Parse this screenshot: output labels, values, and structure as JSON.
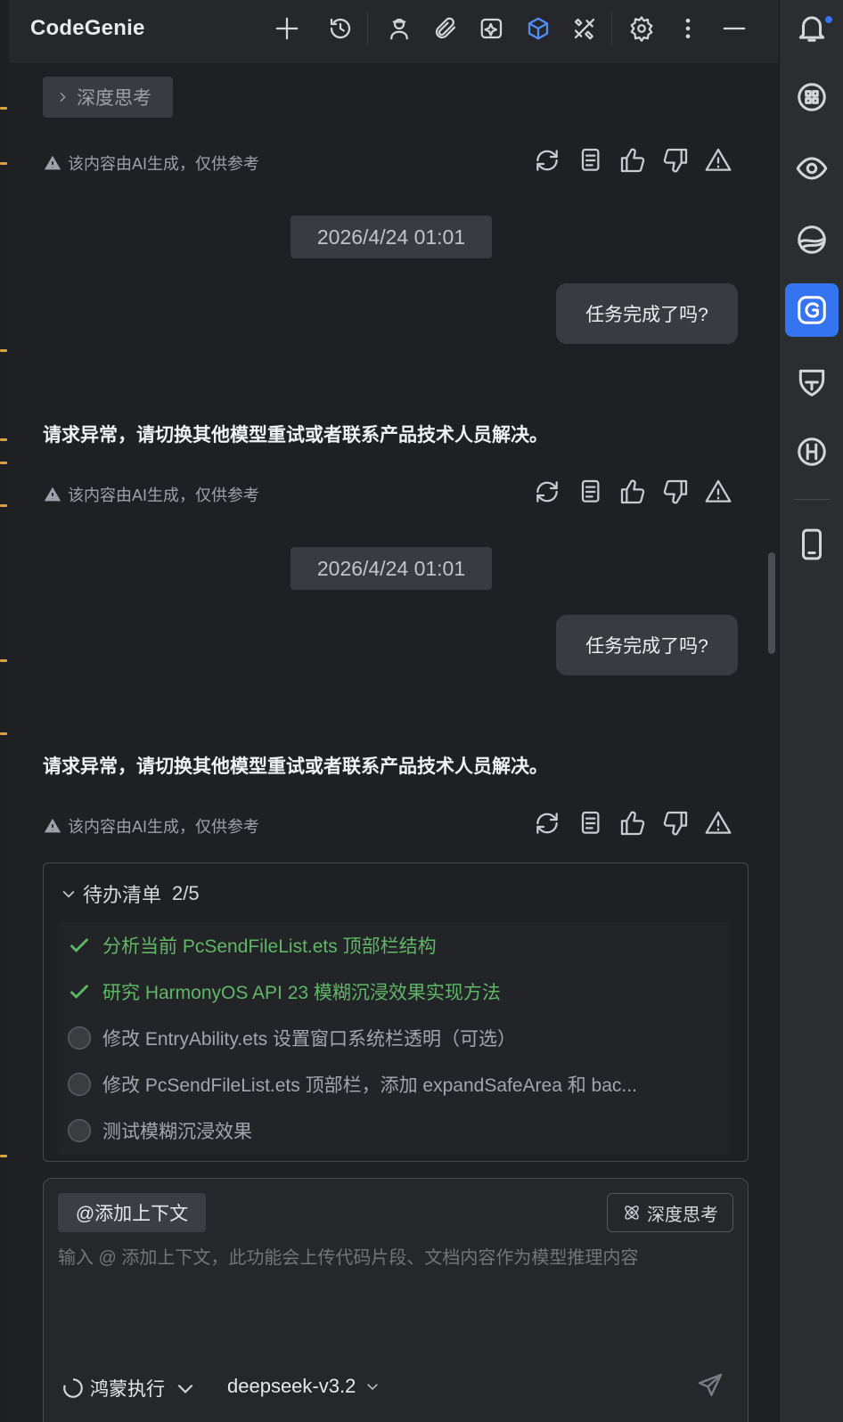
{
  "header": {
    "brand": "CodeGenie",
    "icons": [
      "plus-icon",
      "history-icon",
      "agent-icon",
      "attach-icon",
      "sparkle-icon",
      "cube-icon",
      "tools-icon",
      "gear-icon",
      "more-vertical-icon",
      "minimize-icon"
    ]
  },
  "conversation": {
    "deep_thinking_chip": "深度思考",
    "ai_notice": "该内容由AI生成，仅供参考",
    "entries": [
      {
        "timestamp": "2026/4/24 01:01",
        "user_message": "任务完成了吗?",
        "assistant_message": "请求异常，请切换其他模型重试或者联系产品技术人员解决。"
      },
      {
        "timestamp": "2026/4/24 01:01",
        "user_message": "任务完成了吗?",
        "assistant_message": "请求异常，请切换其他模型重试或者联系产品技术人员解决。"
      }
    ]
  },
  "todo": {
    "title": "待办清单",
    "progress": "2/5",
    "items": [
      {
        "text": "分析当前 PcSendFileList.ets 顶部栏结构",
        "status": "done"
      },
      {
        "text": "研究 HarmonyOS API 23 模糊沉浸效果实现方法",
        "status": "done"
      },
      {
        "text": "修改 EntryAbility.ets 设置窗口系统栏透明（可选）",
        "status": "pending"
      },
      {
        "text": "修改 PcSendFileList.ets 顶部栏，添加 expandSafeArea 和 bac...",
        "status": "pending"
      },
      {
        "text": "测试模糊沉浸效果",
        "status": "pending"
      }
    ]
  },
  "composer": {
    "add_context": "@添加上下文",
    "deep_thinking": "深度思考",
    "placeholder": "输入 @ 添加上下文，此功能会上传代码片段、文档内容作为模型推理内容",
    "mode": "鸿蒙执行",
    "model": "deepseek-v3.2"
  },
  "rail": {
    "icons": [
      "notification-bell-icon",
      "robot-icon",
      "eye-icon",
      "globe-icon",
      "codegenie-g-icon",
      "shield-icon",
      "harmony-h-icon",
      "phone-icon"
    ],
    "active": "codegenie-g-icon"
  },
  "colors": {
    "accent": "#3574f0",
    "done": "#5fb865",
    "panel_bg": "#1f2023",
    "bubble_bg": "#393b40"
  }
}
